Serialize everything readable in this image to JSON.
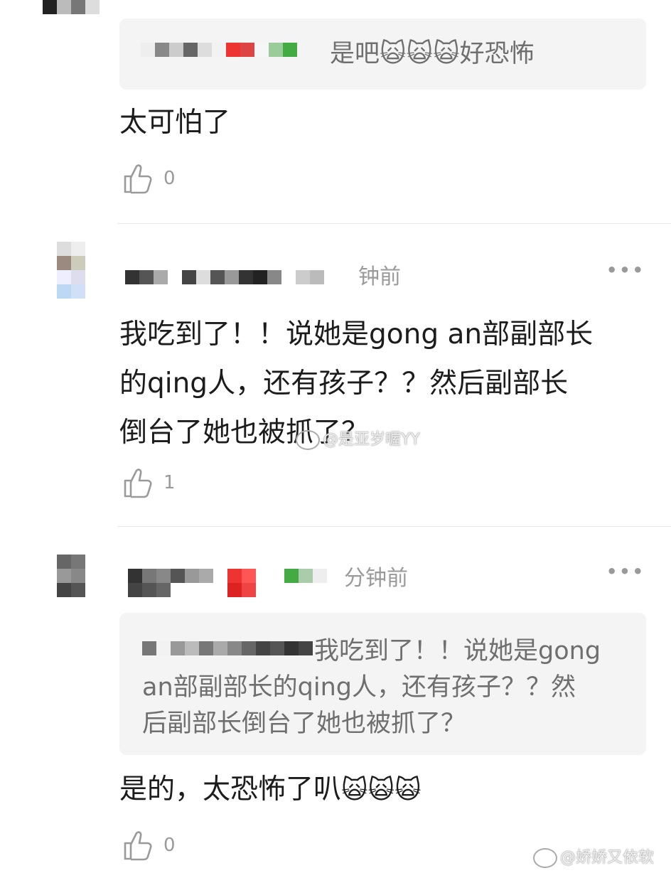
{
  "comments": [
    {
      "quote": {
        "text": "是吧",
        "emoji": "🙀🙀🙀",
        "tail": "好恐怖"
      },
      "body": "太可怕了",
      "likes": "0"
    },
    {
      "time": "钟前",
      "body_lines": [
        "我吃到了！！说她是gong an部副部长",
        "的qing人，还有孩子？？然后副部长",
        "倒台了她也被抓了？"
      ],
      "likes": "1"
    },
    {
      "time": "分钟前",
      "quote": {
        "lines": [
          "我吃到了！！说她是gong",
          "an部副部长的qing人，还有孩子？？然",
          "后副部长倒台了她也被抓了？"
        ]
      },
      "body": "是的，太恐怖了叭",
      "body_emoji": "🙀🙀🙀",
      "likes": "0"
    }
  ],
  "more_label": "•••",
  "watermarks": {
    "middle": "@是亚岁喔YY",
    "bottom": "@娇娇又依软"
  },
  "colors": {
    "quote_bg": "#f4f4f4",
    "gray_text": "#9a9a9a",
    "divider": "#e8e8e8"
  },
  "icons": [
    "thumbs-up-icon",
    "more-icon",
    "weibo-logo-icon"
  ]
}
